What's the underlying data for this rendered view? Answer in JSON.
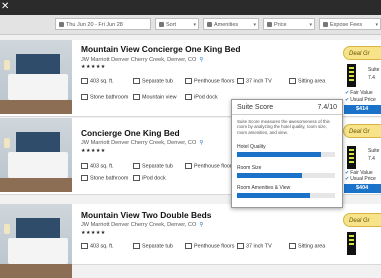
{
  "filters": {
    "dates": "Thu Jun 20 - Fri Jun 28",
    "sort": "Sort",
    "amenities": "Amenities",
    "price": "Price",
    "expose_fees": "Expose Fees"
  },
  "cards": [
    {
      "title": "Mountain View Concierge One King Bed",
      "address": "JW Marriott Denver Cherry Creek, Denver, CO",
      "stars": "★★★★★",
      "features": [
        "403 sq. ft.",
        "Separate tub",
        "Penthouse floors",
        "37 inch TV",
        "Sitting area",
        "Stone bathroom",
        "Mountain view",
        "iPod dock"
      ],
      "deal": "Deal Gr",
      "score_label": "Suite",
      "score_value": "7.4",
      "fair": "Fair Value",
      "usual": "Usual Price",
      "price": "$414"
    },
    {
      "title": "Concierge One King Bed",
      "address": "JW Marriott Denver Cherry Creek, Denver, CO",
      "stars": "★★★★★",
      "features": [
        "403 sq. ft.",
        "Separate tub",
        "Penthouse floors",
        "Stone bathroom",
        "iPod dock"
      ],
      "deal": "Deal Gr",
      "score_label": "Suite",
      "score_value": "7.4",
      "fair": "Fair Value",
      "usual": "Usual Price",
      "price": "$404"
    },
    {
      "title": "Mountain View Two Double Beds",
      "address": "JW Marriott Denver Cherry Creek, Denver, CO",
      "stars": "★★★★★",
      "features": [
        "403 sq. ft.",
        "Separate tub",
        "Penthouse floors",
        "37 inch TV",
        "Sitting area"
      ],
      "deal": "Deal Gr"
    }
  ],
  "popup": {
    "title": "Suite Score",
    "score": "7.4/10",
    "description": "Suite Score measures the awesomeness of this room by analyzing the hotel quality, room size, room amenities, and view.",
    "metrics": [
      {
        "label": "Hotel Quality",
        "fraction": 0.86
      },
      {
        "label": "Room Size",
        "fraction": 0.66
      },
      {
        "label": "Room Amenities & View",
        "fraction": 0.74
      }
    ]
  },
  "colors": {
    "accent": "#1a73c8",
    "deal": "#f6e38a",
    "topbar": "#2b2b2b"
  }
}
